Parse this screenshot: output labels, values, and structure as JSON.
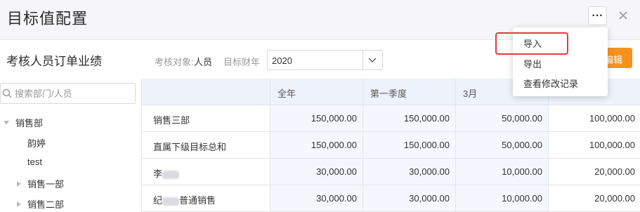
{
  "header": {
    "title": "目标值配置",
    "more_label": "···"
  },
  "toolbar": {
    "section_title": "考核人员订单业绩",
    "target_label": "考核对象:",
    "target_value": "人员",
    "year_label": "目标财年",
    "year_value": "2020",
    "edit_label": "编辑"
  },
  "sidebar": {
    "search_placeholder": "搜索部门/人员",
    "tree": [
      {
        "label": "销售部",
        "expanded": true
      },
      {
        "label": "韵婷"
      },
      {
        "label": "test"
      },
      {
        "label": "销售一部",
        "expanded": false
      },
      {
        "label": "销售二部",
        "expanded": false
      }
    ]
  },
  "table": {
    "columns": [
      "",
      "全年",
      "第一季度",
      "3月",
      ""
    ],
    "rows": [
      {
        "name": "销售三部",
        "values": [
          "150,000.00",
          "150,000.00",
          "50,000.00",
          "100,000.00"
        ]
      },
      {
        "name": "直属下级目标总和",
        "values": [
          "150,000.00",
          "150,000.00",
          "50,000.00",
          "100,000.00"
        ]
      },
      {
        "name_prefix": "李",
        "name_suffix": "",
        "values": [
          "30,000.00",
          "30,000.00",
          "10,000.00",
          "20,000.00"
        ]
      },
      {
        "name_prefix": "纪",
        "name_suffix": "普通销售",
        "values": [
          "30,000.00",
          "30,000.00",
          "10,000.00",
          "20,000.00"
        ]
      }
    ]
  },
  "menu": {
    "items": [
      "导入",
      "导出",
      "查看修改记录"
    ],
    "highlighted_item": "导入"
  },
  "colors": {
    "accent": "#f5921e",
    "highlight": "#e8383d",
    "header_bg": "#eef2fa"
  }
}
